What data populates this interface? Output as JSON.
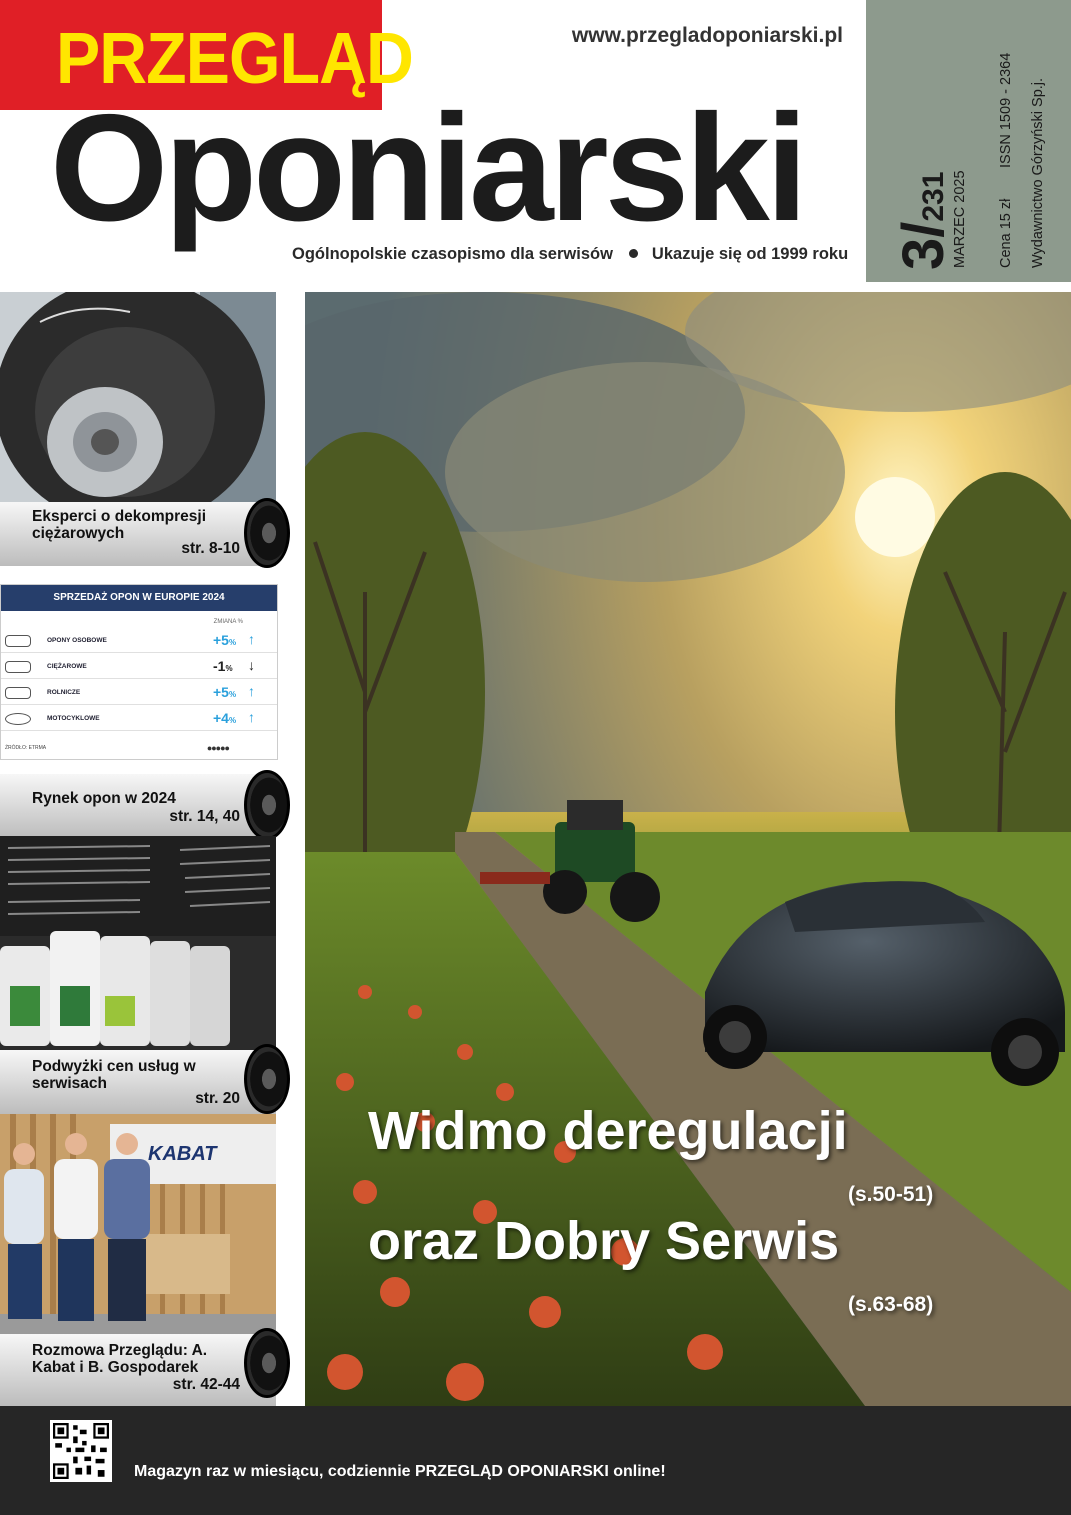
{
  "masthead": {
    "title_top": "PRZEGLĄD",
    "title_main": "Oponiarski",
    "url": "www.przegladoponiarski.pl",
    "tagline_left": "Ogólnopolskie czasopismo dla serwisów",
    "tagline_right": "Ukazuje się od 1999 roku"
  },
  "issue": {
    "number": "3/",
    "total": "231",
    "month": "MARZEC 2025",
    "price": "Cena 15 zł",
    "issn": "ISSN 1509 - 2364",
    "publisher": "Wydawnictwo Górzyński Sp.j."
  },
  "sidebar": [
    {
      "title": "Eksperci o dekompresji ciężarowych",
      "pages": "str. 8-10"
    },
    {
      "title": "Rynek opon w 2024",
      "pages": "str. 14, 40"
    },
    {
      "title": "Podwyżki cen usług w serwisach",
      "pages": "str. 20"
    },
    {
      "title": "Rozmowa Przeglądu: A. Kabat i B. Gospodarek",
      "pages": "str. 42-44"
    }
  ],
  "europe_table": {
    "title": "SPRZEDAŻ OPON W EUROPIE 2024",
    "change_header": "ZMIANA %",
    "rows": [
      {
        "label": "OPONY OSOBOWE",
        "value": "+5",
        "unit": "%",
        "arrow": "↑"
      },
      {
        "label": "CIĘŻAROWE",
        "value": "-1",
        "unit": "%",
        "arrow": "↓"
      },
      {
        "label": "ROLNICZE",
        "value": "+5",
        "unit": "%",
        "arrow": "↑"
      },
      {
        "label": "MOTOCYKLOWE",
        "value": "+4",
        "unit": "%",
        "arrow": "↑"
      }
    ],
    "source": "ŹRÓDŁO: ETRMA"
  },
  "headlines": {
    "line1": "Widmo deregulacji",
    "pages1": "(s.50-51)",
    "line2": "oraz Dobry Serwis",
    "pages2": "(s.63-68)"
  },
  "photo_text": {
    "kabat_sign": "KABAT"
  },
  "footer": {
    "text": "Magazyn raz w miesiącu, codziennie PRZEGLĄD OPONIARSKI online!"
  }
}
